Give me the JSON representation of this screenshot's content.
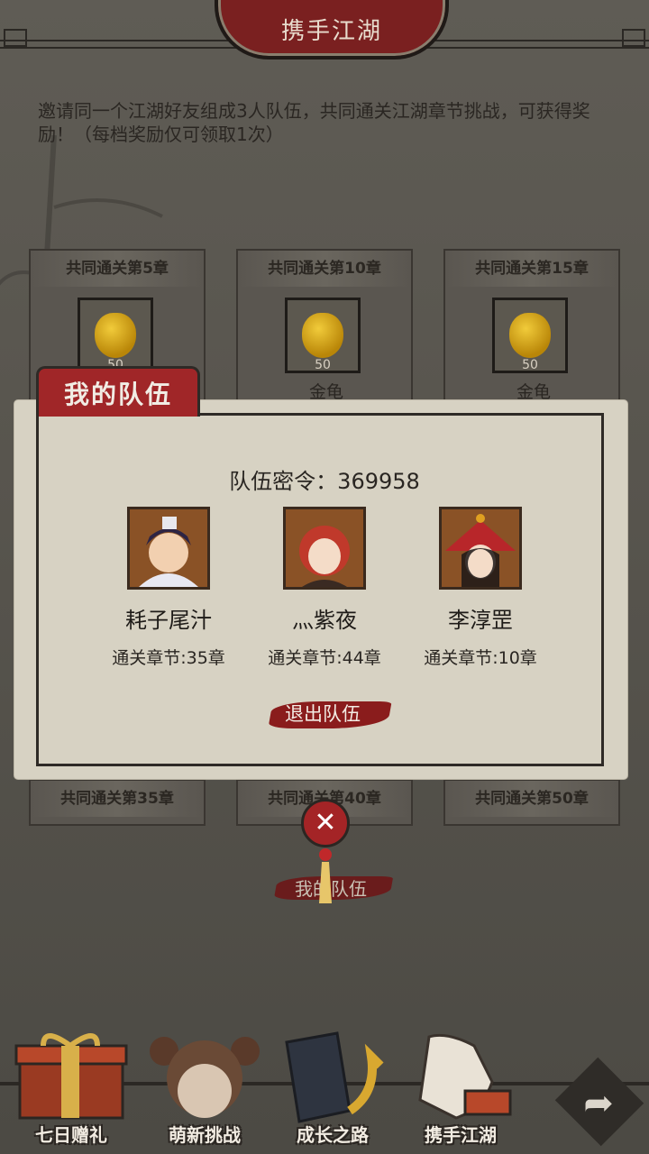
{
  "header": {
    "title": "携手江湖"
  },
  "description": "邀请同一个江湖好友组成3人队伍，共同通关江湖章节挑战，可获得奖励！（每档奖励仅可领取1次）",
  "rewards_top": [
    {
      "label": "共同通关第5章",
      "amount": "50",
      "item": ""
    },
    {
      "label": "共同通关第10章",
      "amount": "50",
      "item": "金龟"
    },
    {
      "label": "共同通关第15章",
      "amount": "50",
      "item": "金龟"
    }
  ],
  "rewards_bottom": [
    {
      "label": "共同通关第35章"
    },
    {
      "label": "共同通关第40章"
    },
    {
      "label": "共同通关第50章"
    }
  ],
  "team_dialog": {
    "tab_title": "我的队伍",
    "code_text": "队伍密令：369958",
    "members": [
      {
        "name": "耗子尾汁",
        "chapter": "通关章节:35章"
      },
      {
        "name": "灬紫夜",
        "chapter": "通关章节:44章"
      },
      {
        "name": "李淳罡",
        "chapter": "通关章节:10章"
      }
    ],
    "quit_label": "退出队伍"
  },
  "my_team_button": "我的队伍",
  "bottom_nav": [
    {
      "label": "七日赠礼",
      "icon": "gift-box-icon"
    },
    {
      "label": "萌新挑战",
      "icon": "girl-character-icon"
    },
    {
      "label": "成长之路",
      "icon": "book-icon"
    },
    {
      "label": "携手江湖",
      "icon": "handshake-icon"
    }
  ],
  "colors": {
    "accent_red": "#a02628",
    "paper": "#d7d2c3",
    "gold": "#e0b020"
  }
}
